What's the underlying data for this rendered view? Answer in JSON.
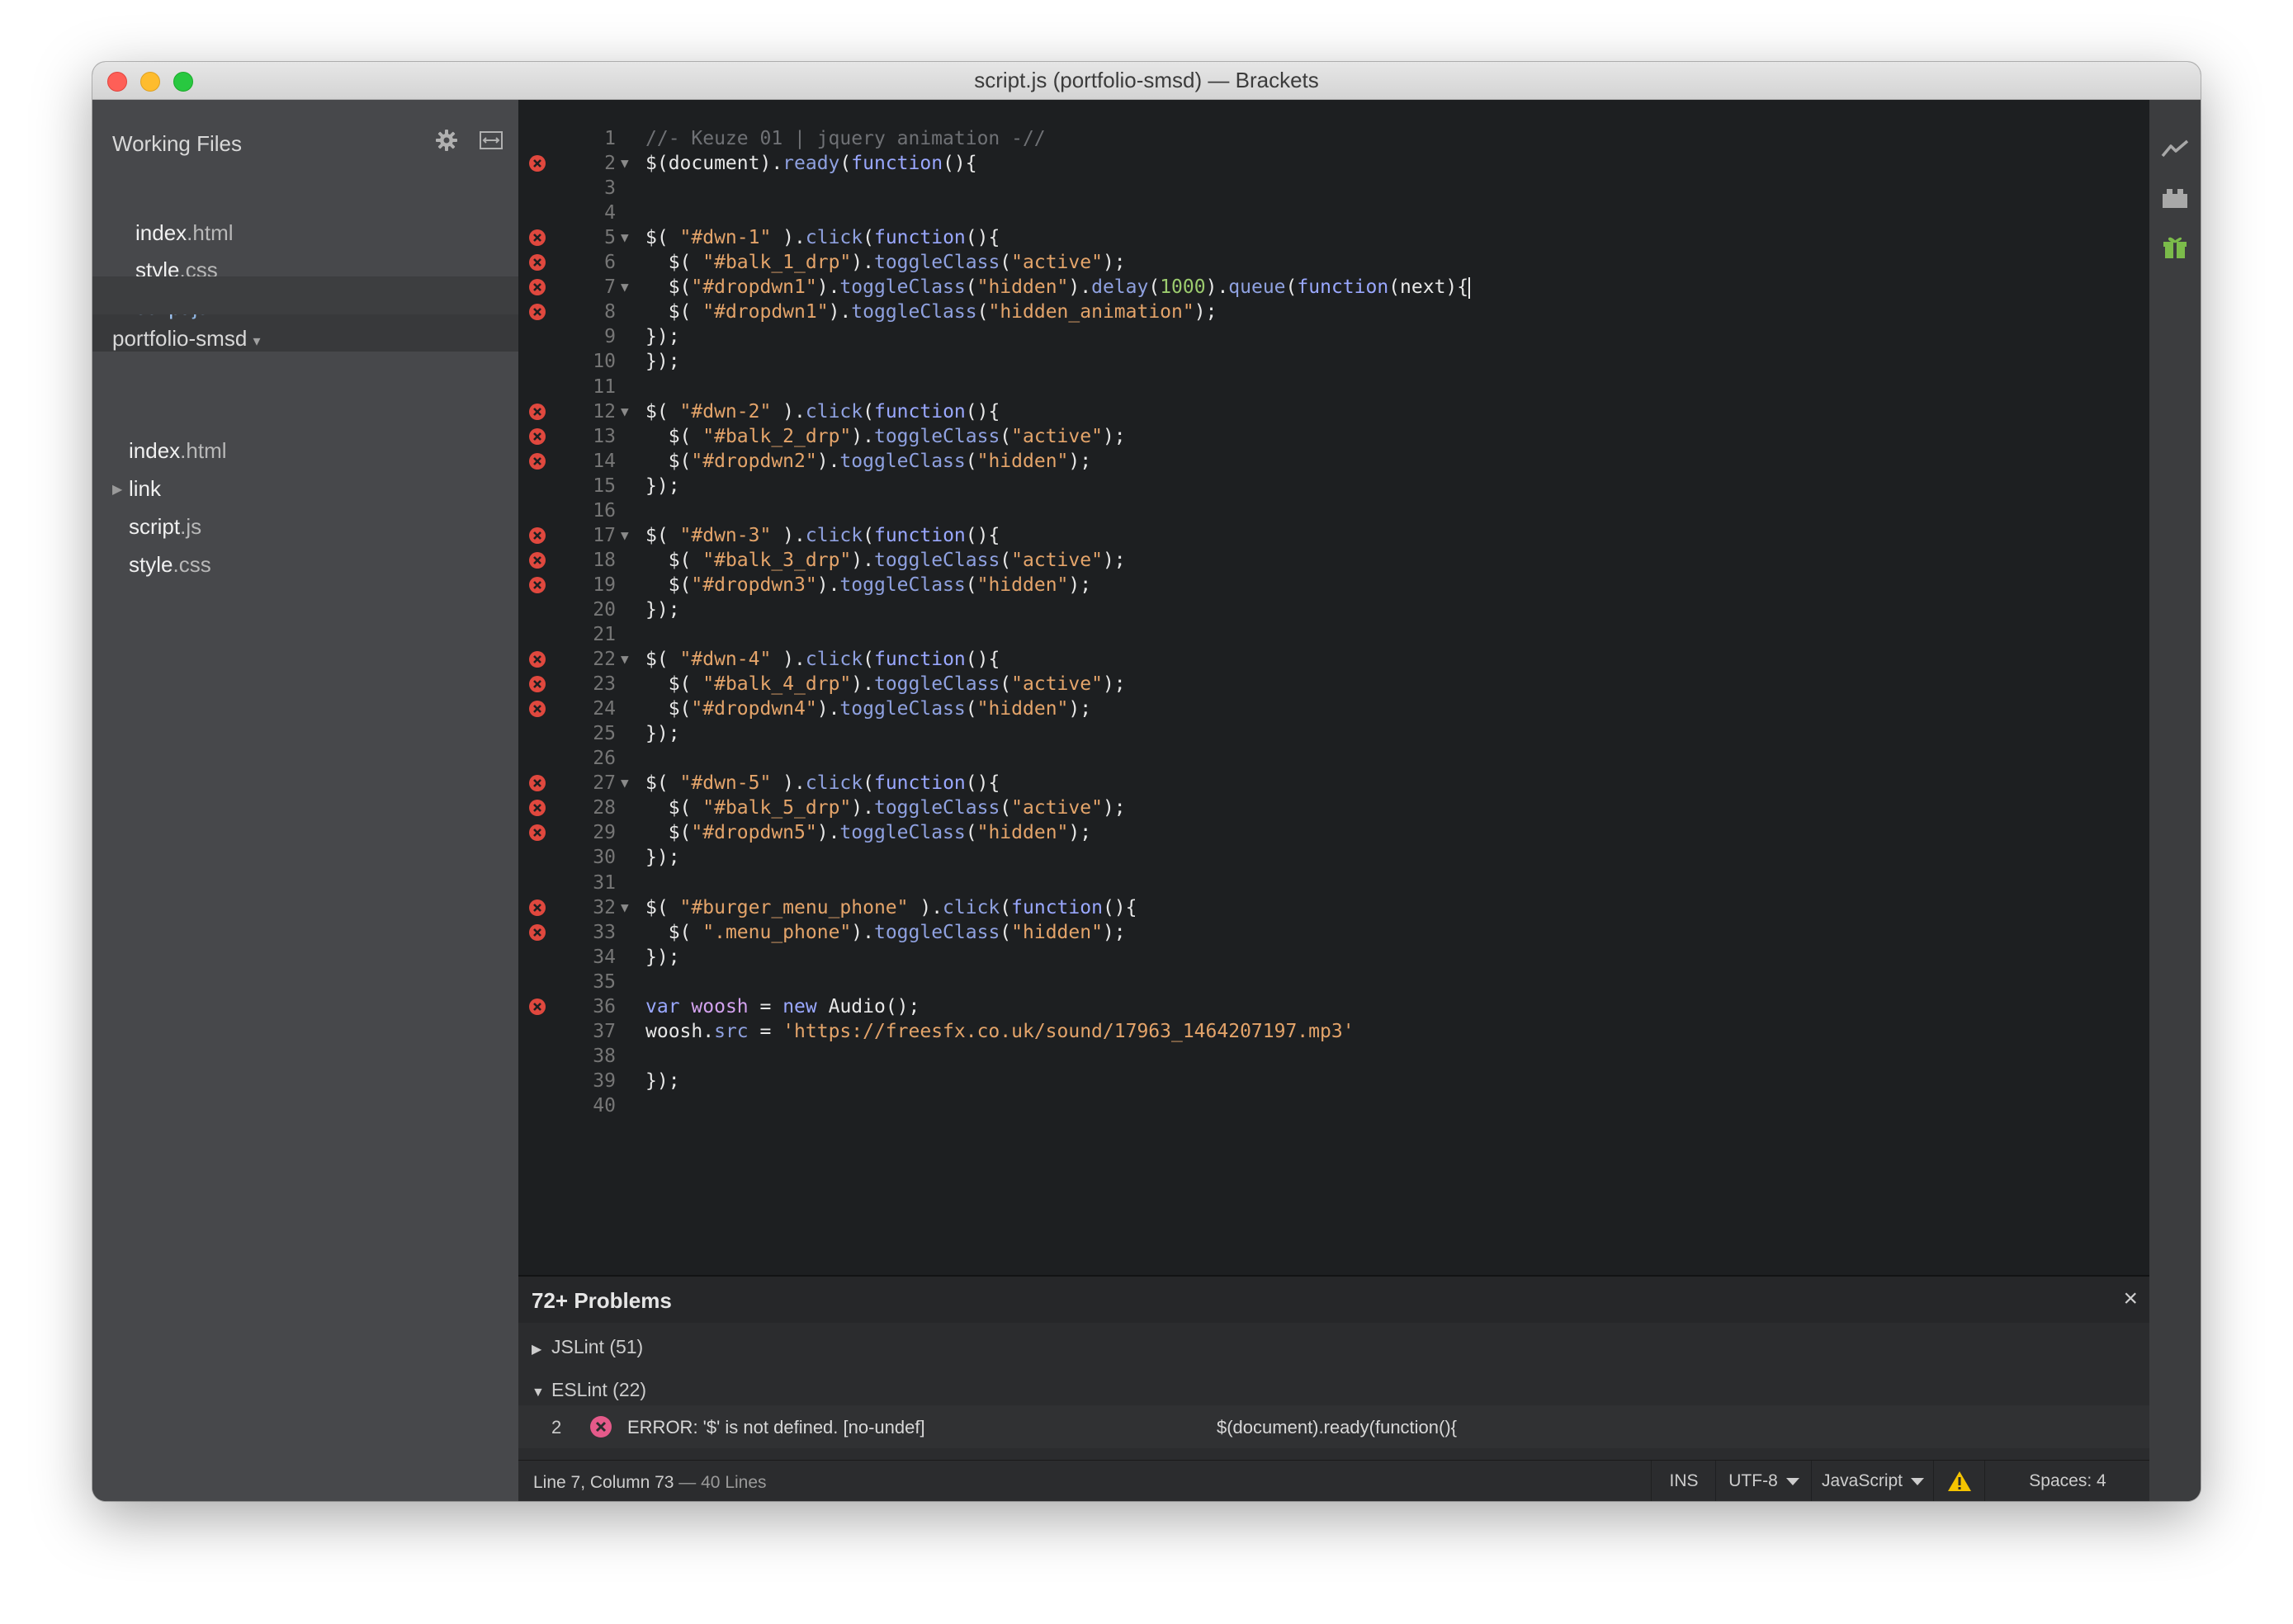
{
  "window": {
    "title": "script.js (portfolio-smsd) — Brackets"
  },
  "sidebar": {
    "working_files_title": "Working Files",
    "working_files": [
      {
        "name": "index",
        "ext": ".html",
        "selected": false
      },
      {
        "name": "style",
        "ext": ".css",
        "selected": false
      },
      {
        "name": "script",
        "ext": ".js",
        "selected": true
      }
    ],
    "project_name": "portfolio-smsd",
    "project_caret": "▾",
    "tree": [
      {
        "name": "index",
        "ext": ".html",
        "folder": false
      },
      {
        "name": "link",
        "ext": "",
        "folder": true
      },
      {
        "name": "script",
        "ext": ".js",
        "folder": false
      },
      {
        "name": "style",
        "ext": ".css",
        "folder": false
      }
    ]
  },
  "editor": {
    "lines": [
      {
        "n": "1",
        "err": false,
        "fold": false,
        "tokens": [
          [
            "c-com",
            "//- Keuze 01 | jquery animation -//"
          ]
        ]
      },
      {
        "n": "2",
        "err": true,
        "fold": true,
        "tokens": [
          [
            "",
            "$(document)."
          ],
          [
            "c-fn",
            "ready"
          ],
          [
            "",
            "("
          ],
          [
            "c-kw",
            "function"
          ],
          [
            "",
            "(){"
          ]
        ]
      },
      {
        "n": "3",
        "err": false,
        "fold": false,
        "tokens": []
      },
      {
        "n": "4",
        "err": false,
        "fold": false,
        "tokens": []
      },
      {
        "n": "5",
        "err": true,
        "fold": true,
        "tokens": [
          [
            "",
            "$( "
          ],
          [
            "c-str",
            "\"#dwn-1\""
          ],
          [
            "",
            " )."
          ],
          [
            "c-fn",
            "click"
          ],
          [
            "",
            "("
          ],
          [
            "c-kw",
            "function"
          ],
          [
            "",
            "(){"
          ]
        ]
      },
      {
        "n": "6",
        "err": true,
        "fold": false,
        "tokens": [
          [
            "",
            "  $( "
          ],
          [
            "c-str",
            "\"#balk_1_drp\""
          ],
          [
            "",
            ")."
          ],
          [
            "c-fn",
            "toggleClass"
          ],
          [
            "",
            "("
          ],
          [
            "c-str",
            "\"active\""
          ],
          [
            "",
            ");"
          ]
        ]
      },
      {
        "n": "7",
        "err": true,
        "fold": true,
        "caret": true,
        "tokens": [
          [
            "",
            "  $("
          ],
          [
            "c-str",
            "\"#dropdwn1\""
          ],
          [
            "",
            ")."
          ],
          [
            "c-fn",
            "toggleClass"
          ],
          [
            "",
            "("
          ],
          [
            "c-str",
            "\"hidden\""
          ],
          [
            "",
            ")."
          ],
          [
            "c-fn",
            "delay"
          ],
          [
            "",
            "("
          ],
          [
            "c-num",
            "1000"
          ],
          [
            "",
            ")."
          ],
          [
            "c-fn",
            "queue"
          ],
          [
            "",
            "("
          ],
          [
            "c-kw",
            "function"
          ],
          [
            "",
            "(next){"
          ]
        ]
      },
      {
        "n": "8",
        "err": true,
        "fold": false,
        "tokens": [
          [
            "",
            "  $( "
          ],
          [
            "c-str",
            "\"#dropdwn1\""
          ],
          [
            "",
            ")."
          ],
          [
            "c-fn",
            "toggleClass"
          ],
          [
            "",
            "("
          ],
          [
            "c-str",
            "\"hidden_animation\""
          ],
          [
            "",
            ");"
          ]
        ]
      },
      {
        "n": "9",
        "err": false,
        "fold": false,
        "tokens": [
          [
            "",
            "});"
          ]
        ]
      },
      {
        "n": "10",
        "err": false,
        "fold": false,
        "tokens": [
          [
            "",
            "});"
          ]
        ]
      },
      {
        "n": "11",
        "err": false,
        "fold": false,
        "tokens": []
      },
      {
        "n": "12",
        "err": true,
        "fold": true,
        "tokens": [
          [
            "",
            "$( "
          ],
          [
            "c-str",
            "\"#dwn-2\""
          ],
          [
            "",
            " )."
          ],
          [
            "c-fn",
            "click"
          ],
          [
            "",
            "("
          ],
          [
            "c-kw",
            "function"
          ],
          [
            "",
            "(){"
          ]
        ]
      },
      {
        "n": "13",
        "err": true,
        "fold": false,
        "tokens": [
          [
            "",
            "  $( "
          ],
          [
            "c-str",
            "\"#balk_2_drp\""
          ],
          [
            "",
            ")."
          ],
          [
            "c-fn",
            "toggleClass"
          ],
          [
            "",
            "("
          ],
          [
            "c-str",
            "\"active\""
          ],
          [
            "",
            ");"
          ]
        ]
      },
      {
        "n": "14",
        "err": true,
        "fold": false,
        "tokens": [
          [
            "",
            "  $("
          ],
          [
            "c-str",
            "\"#dropdwn2\""
          ],
          [
            "",
            ")."
          ],
          [
            "c-fn",
            "toggleClass"
          ],
          [
            "",
            "("
          ],
          [
            "c-str",
            "\"hidden\""
          ],
          [
            "",
            ");"
          ]
        ]
      },
      {
        "n": "15",
        "err": false,
        "fold": false,
        "tokens": [
          [
            "",
            "});"
          ]
        ]
      },
      {
        "n": "16",
        "err": false,
        "fold": false,
        "tokens": []
      },
      {
        "n": "17",
        "err": true,
        "fold": true,
        "tokens": [
          [
            "",
            "$( "
          ],
          [
            "c-str",
            "\"#dwn-3\""
          ],
          [
            "",
            " )."
          ],
          [
            "c-fn",
            "click"
          ],
          [
            "",
            "("
          ],
          [
            "c-kw",
            "function"
          ],
          [
            "",
            "(){"
          ]
        ]
      },
      {
        "n": "18",
        "err": true,
        "fold": false,
        "tokens": [
          [
            "",
            "  $( "
          ],
          [
            "c-str",
            "\"#balk_3_drp\""
          ],
          [
            "",
            ")."
          ],
          [
            "c-fn",
            "toggleClass"
          ],
          [
            "",
            "("
          ],
          [
            "c-str",
            "\"active\""
          ],
          [
            "",
            ");"
          ]
        ]
      },
      {
        "n": "19",
        "err": true,
        "fold": false,
        "tokens": [
          [
            "",
            "  $("
          ],
          [
            "c-str",
            "\"#dropdwn3\""
          ],
          [
            "",
            ")."
          ],
          [
            "c-fn",
            "toggleClass"
          ],
          [
            "",
            "("
          ],
          [
            "c-str",
            "\"hidden\""
          ],
          [
            "",
            ");"
          ]
        ]
      },
      {
        "n": "20",
        "err": false,
        "fold": false,
        "tokens": [
          [
            "",
            "});"
          ]
        ]
      },
      {
        "n": "21",
        "err": false,
        "fold": false,
        "tokens": []
      },
      {
        "n": "22",
        "err": true,
        "fold": true,
        "tokens": [
          [
            "",
            "$( "
          ],
          [
            "c-str",
            "\"#dwn-4\""
          ],
          [
            "",
            " )."
          ],
          [
            "c-fn",
            "click"
          ],
          [
            "",
            "("
          ],
          [
            "c-kw",
            "function"
          ],
          [
            "",
            "(){"
          ]
        ]
      },
      {
        "n": "23",
        "err": true,
        "fold": false,
        "tokens": [
          [
            "",
            "  $( "
          ],
          [
            "c-str",
            "\"#balk_4_drp\""
          ],
          [
            "",
            ")."
          ],
          [
            "c-fn",
            "toggleClass"
          ],
          [
            "",
            "("
          ],
          [
            "c-str",
            "\"active\""
          ],
          [
            "",
            ");"
          ]
        ]
      },
      {
        "n": "24",
        "err": true,
        "fold": false,
        "tokens": [
          [
            "",
            "  $("
          ],
          [
            "c-str",
            "\"#dropdwn4\""
          ],
          [
            "",
            ")."
          ],
          [
            "c-fn",
            "toggleClass"
          ],
          [
            "",
            "("
          ],
          [
            "c-str",
            "\"hidden\""
          ],
          [
            "",
            ");"
          ]
        ]
      },
      {
        "n": "25",
        "err": false,
        "fold": false,
        "tokens": [
          [
            "",
            "});"
          ]
        ]
      },
      {
        "n": "26",
        "err": false,
        "fold": false,
        "tokens": []
      },
      {
        "n": "27",
        "err": true,
        "fold": true,
        "tokens": [
          [
            "",
            "$( "
          ],
          [
            "c-str",
            "\"#dwn-5\""
          ],
          [
            "",
            " )."
          ],
          [
            "c-fn",
            "click"
          ],
          [
            "",
            "("
          ],
          [
            "c-kw",
            "function"
          ],
          [
            "",
            "(){"
          ]
        ]
      },
      {
        "n": "28",
        "err": true,
        "fold": false,
        "tokens": [
          [
            "",
            "  $( "
          ],
          [
            "c-str",
            "\"#balk_5_drp\""
          ],
          [
            "",
            ")."
          ],
          [
            "c-fn",
            "toggleClass"
          ],
          [
            "",
            "("
          ],
          [
            "c-str",
            "\"active\""
          ],
          [
            "",
            ");"
          ]
        ]
      },
      {
        "n": "29",
        "err": true,
        "fold": false,
        "tokens": [
          [
            "",
            "  $("
          ],
          [
            "c-str",
            "\"#dropdwn5\""
          ],
          [
            "",
            ")."
          ],
          [
            "c-fn",
            "toggleClass"
          ],
          [
            "",
            "("
          ],
          [
            "c-str",
            "\"hidden\""
          ],
          [
            "",
            ");"
          ]
        ]
      },
      {
        "n": "30",
        "err": false,
        "fold": false,
        "tokens": [
          [
            "",
            "});"
          ]
        ]
      },
      {
        "n": "31",
        "err": false,
        "fold": false,
        "tokens": []
      },
      {
        "n": "32",
        "err": true,
        "fold": true,
        "tokens": [
          [
            "",
            "$( "
          ],
          [
            "c-str",
            "\"#burger_menu_phone\""
          ],
          [
            "",
            " )."
          ],
          [
            "c-fn",
            "click"
          ],
          [
            "",
            "("
          ],
          [
            "c-kw",
            "function"
          ],
          [
            "",
            "(){"
          ]
        ]
      },
      {
        "n": "33",
        "err": true,
        "fold": false,
        "tokens": [
          [
            "",
            "  $( "
          ],
          [
            "c-str",
            "\".menu_phone\""
          ],
          [
            "",
            ")."
          ],
          [
            "c-fn",
            "toggleClass"
          ],
          [
            "",
            "("
          ],
          [
            "c-str",
            "\"hidden\""
          ],
          [
            "",
            ");"
          ]
        ]
      },
      {
        "n": "34",
        "err": false,
        "fold": false,
        "tokens": [
          [
            "",
            "});"
          ]
        ]
      },
      {
        "n": "35",
        "err": false,
        "fold": false,
        "tokens": []
      },
      {
        "n": "36",
        "err": true,
        "fold": false,
        "tokens": [
          [
            "c-kw",
            "var"
          ],
          [
            "",
            " "
          ],
          [
            "c-var",
            "woosh"
          ],
          [
            "",
            " = "
          ],
          [
            "c-kw",
            "new"
          ],
          [
            "",
            " Audio();"
          ]
        ]
      },
      {
        "n": "37",
        "err": false,
        "fold": false,
        "tokens": [
          [
            "",
            "woosh."
          ],
          [
            "c-fn",
            "src"
          ],
          [
            "",
            " = "
          ],
          [
            "c-str",
            "'https://freesfx.co.uk/sound/17963_1464207197.mp3'"
          ]
        ]
      },
      {
        "n": "38",
        "err": false,
        "fold": false,
        "tokens": []
      },
      {
        "n": "39",
        "err": false,
        "fold": false,
        "tokens": [
          [
            "",
            "});"
          ]
        ]
      },
      {
        "n": "40",
        "err": false,
        "fold": false,
        "tokens": []
      }
    ]
  },
  "problems": {
    "title": "72+ Problems",
    "close": "×",
    "groups": [
      {
        "label": "JSLint (51)",
        "expanded": false,
        "arrow": "▶"
      },
      {
        "label": "ESLint (22)",
        "expanded": true,
        "arrow": "▼"
      }
    ],
    "row": {
      "line": "2",
      "message": "ERROR: '$' is not defined. [no-undef]",
      "source": "$(document).ready(function(){"
    }
  },
  "status": {
    "position": "Line 7, Column 73",
    "lines": "— 40 Lines",
    "mode": "INS",
    "encoding": "UTF-8",
    "language": "JavaScript",
    "spaces": "Spaces: 4"
  },
  "colors": {
    "error": "#e0483e",
    "warning": "#f5c400",
    "extract_icon": "#7bbb4a"
  },
  "icons": [
    "gear-icon",
    "split-view-icon",
    "live-preview-icon",
    "extension-manager-icon",
    "extract-icon",
    "error-icon",
    "warning-icon",
    "close-icon"
  ]
}
